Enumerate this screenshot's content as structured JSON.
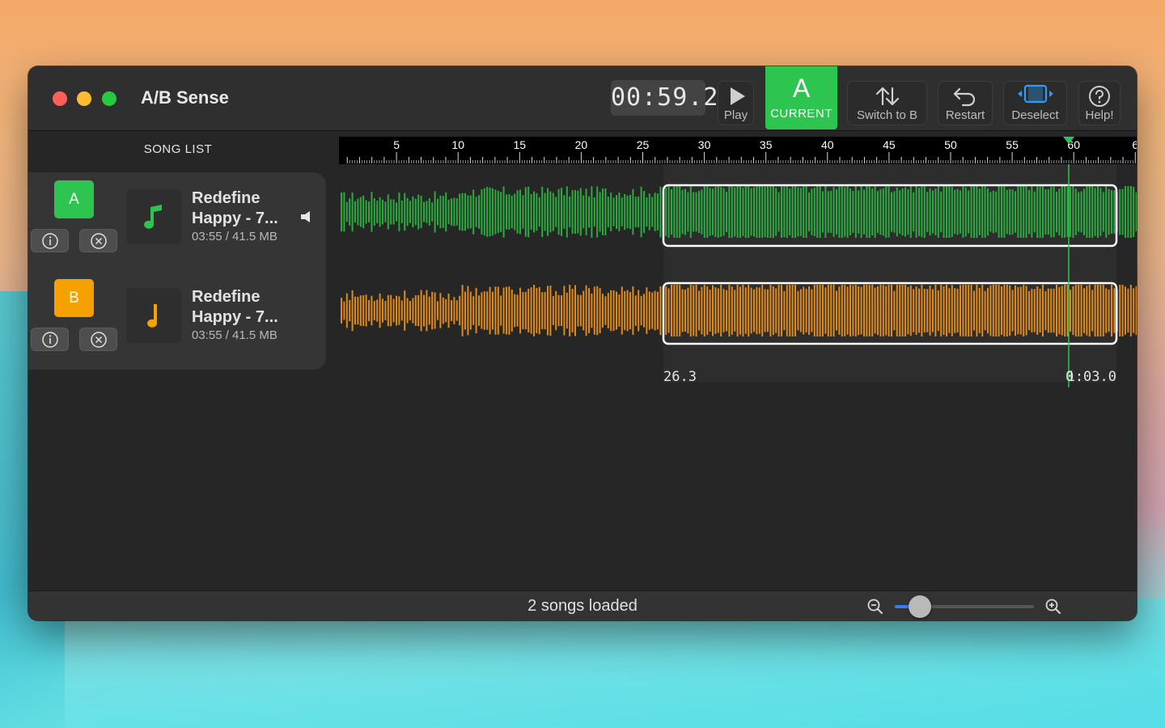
{
  "app": {
    "title": "A/B Sense"
  },
  "toolbar": {
    "timer": "00:59.2",
    "play_label": "Play",
    "current_letter": "A",
    "current_label": "CURRENT",
    "switch_label": "Switch to B",
    "restart_label": "Restart",
    "deselect_label": "Deselect",
    "help_label": "Help!"
  },
  "sidebar": {
    "title": "SONG LIST",
    "songs": [
      {
        "badge": "A",
        "badge_color": "#2ec450",
        "title": "Redefine Happy - 7...",
        "meta": "03:55 / 41.5 MB",
        "icon_color": "#2ec450"
      },
      {
        "badge": "B",
        "badge_color": "#f5a100",
        "title": "Redefine Happy - 7...",
        "meta": "03:55 / 41.5 MB",
        "icon_color": "#f5a100"
      }
    ]
  },
  "timeline": {
    "ticks": [
      "5",
      "10",
      "15",
      "20",
      "25",
      "30",
      "35",
      "40",
      "45",
      "50",
      "55",
      "60",
      "6"
    ],
    "selection_start": "26.3",
    "selection_end": "1:03.0",
    "selection_end_prefix": "0",
    "playhead_color": "#2ec450"
  },
  "tracks": {
    "a_color": "#2bab3f",
    "b_color": "#e08a1a"
  },
  "status": {
    "text": "2 songs loaded",
    "zoom_level": 0.18
  }
}
